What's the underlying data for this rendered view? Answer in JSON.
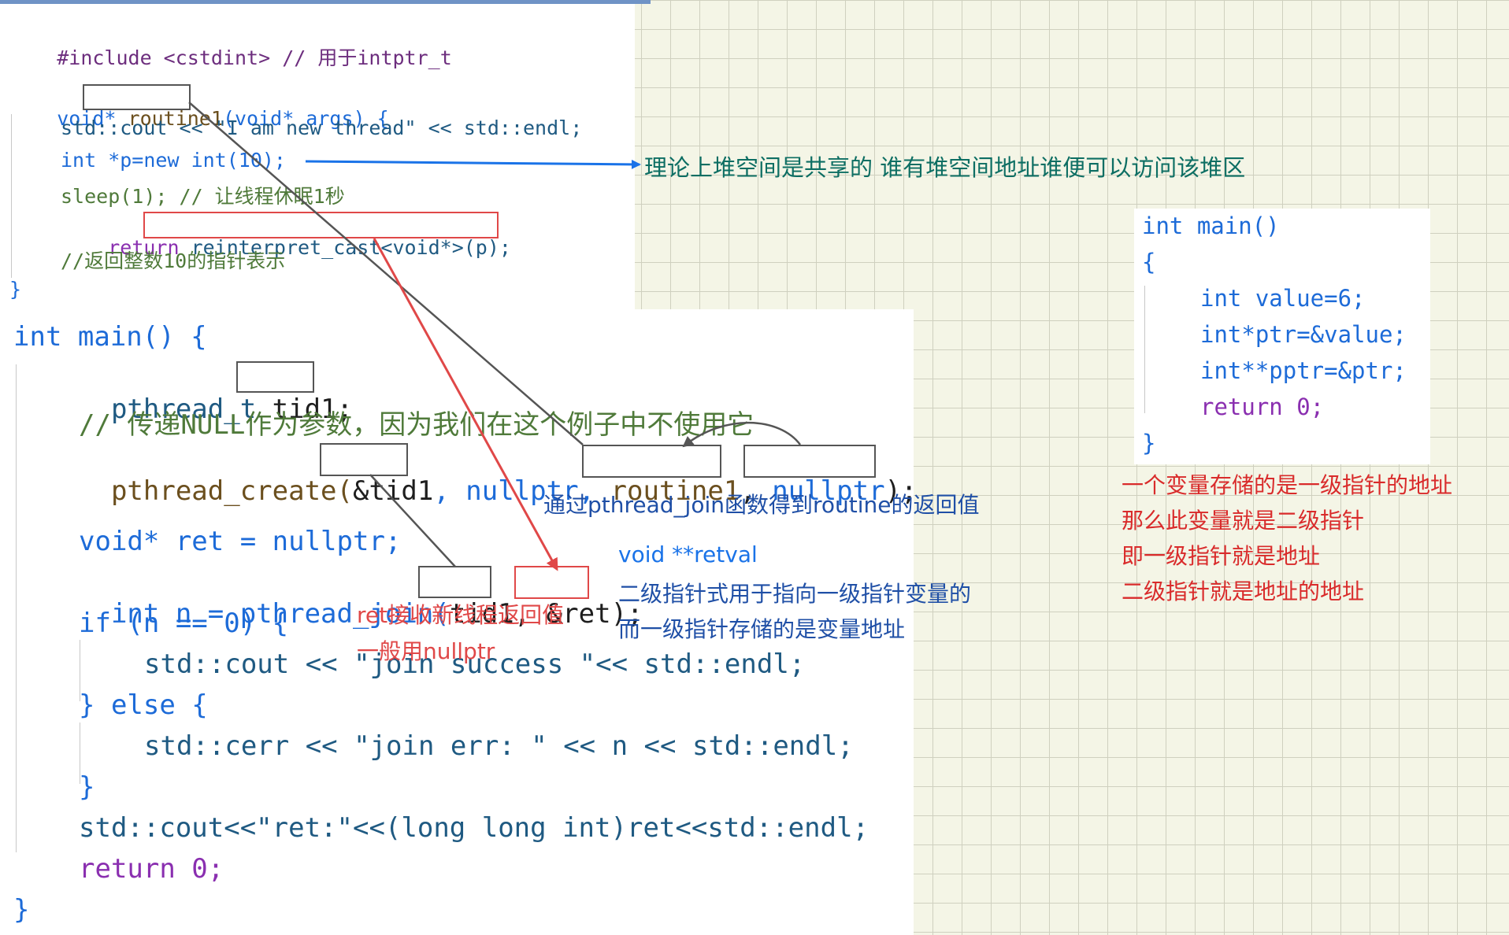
{
  "top_code": {
    "line1": "#include <cstdint> // 用于intptr_t",
    "line2_a": "void* ",
    "line2_fn": "routine1",
    "line2_b": "(void* args) {",
    "line3": "std::cout << \"I am new thread\" << std::endl;",
    "line4": "int *p=new int(10);",
    "line5": "sleep(1); // 让线程休眠1秒",
    "line6_a": "return ",
    "line6_b": "reinterpret_cast<void*>(p);",
    "line7": "//返回整数10的指针表示",
    "line8": "}"
  },
  "main_code": {
    "l1": "int main() {",
    "l2_a": "pthread_t ",
    "l2_b": "tid1",
    "l2_c": ";",
    "l3": "// 传递NULL作为参数，因为我们在这个例子中不使用它",
    "l4_a": "pthread_create(",
    "l4_b": "&tid1",
    "l4_c": ", nullptr, ",
    "l4_d": "routine1",
    "l4_e": ", ",
    "l4_f": "nullptr",
    "l4_g": ");",
    "l5": "void* ret = nullptr;",
    "l6_a": "int n = pthread_join(",
    "l6_b": "tid1",
    "l6_c": ", ",
    "l6_d": "&ret",
    "l6_e": ");",
    "l7": "if (n == 0) {",
    "l8": "std::cout << \"join success \"<< std::endl;",
    "l9": "} else {",
    "l10": "std::cerr << \"join err: \" << n << std::endl;",
    "l11": "}",
    "l12": "std::cout<<\"ret:\"<<(long long int)ret<<std::endl;",
    "l13": "return 0;",
    "l14": "}"
  },
  "right_code": {
    "r1": "int main()",
    "r2": "{",
    "r3": "int value=6;",
    "r4": "int*ptr=&value;",
    "r5": "int**pptr=&ptr;",
    "r6": "return 0;",
    "r7": "}"
  },
  "notes": {
    "heap_shared": "理论上堆空间是共享的 谁有堆空间地址谁便可以访问该堆区",
    "join_get_return": "通过pthread_join函数得到routine的返回值",
    "retval_sig": "void **retval",
    "retval_desc1": "二级指针式用于指向一级指针变量的",
    "retval_desc2": "而一级指针存储的是变量地址",
    "ret_recv1": "ret接收新线程返回值",
    "ret_recv2": "一般用nullptr",
    "pp1": "一个变量存储的是一级指针的地址",
    "pp2": "那么此变量就是二级指针",
    "pp3": "即一级指针就是地址",
    "pp4": "二级指针就是地址的地址"
  },
  "colors": {
    "accent_blue": "#1a73e8",
    "note_teal": "#0d6e63",
    "note_navy": "#1f4fa6",
    "note_red": "#d92b2b",
    "box_red": "#e04848",
    "box_gray": "#555555"
  }
}
